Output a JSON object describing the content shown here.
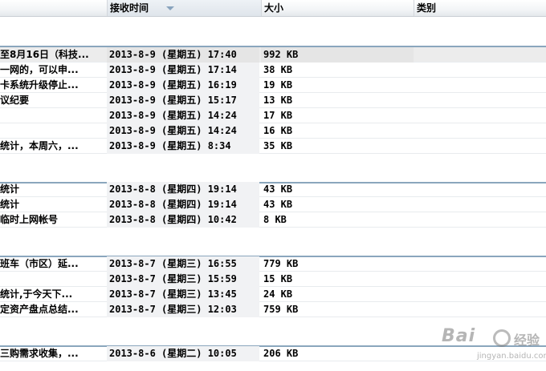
{
  "columns": {
    "time": "接收时间",
    "size": "大小",
    "category": "类别"
  },
  "rows": [
    {
      "subject": "至8月16日（科技...",
      "time": "2013-8-9 (星期五) 17:40",
      "size": "992 KB"
    },
    {
      "subject": "一网的，可以申...",
      "time": "2013-8-9 (星期五) 17:14",
      "size": "38 KB"
    },
    {
      "subject": "卡系统升级停止...",
      "time": "2013-8-9 (星期五) 16:19",
      "size": "19 KB"
    },
    {
      "subject": "议纪要",
      "time": "2013-8-9 (星期五) 15:17",
      "size": "13 KB"
    },
    {
      "subject": "",
      "time": "2013-8-9 (星期五) 14:24",
      "size": "17 KB"
    },
    {
      "subject": "",
      "time": "2013-8-9 (星期五) 14:24",
      "size": "16 KB"
    },
    {
      "subject": "统计，本周六，...",
      "time": "2013-8-9 (星期五) 8:34",
      "size": "35 KB"
    },
    {
      "subject": "统计",
      "time": "2013-8-8 (星期四) 19:14",
      "size": "43 KB"
    },
    {
      "subject": "统计",
      "time": "2013-8-8 (星期四) 19:14",
      "size": "43 KB"
    },
    {
      "subject": "临时上网帐号",
      "time": "2013-8-8 (星期四) 10:42",
      "size": "8 KB"
    },
    {
      "subject": "班车（市区）延...",
      "time": "2013-8-7 (星期三) 16:55",
      "size": "779 KB"
    },
    {
      "subject": "",
      "time": "2013-8-7 (星期三) 15:59",
      "size": "15 KB"
    },
    {
      "subject": "统计,于今天下...",
      "time": "2013-8-7 (星期三) 13:45",
      "size": "24 KB"
    },
    {
      "subject": "定资产盘点总结...",
      "time": "2013-8-7 (星期三) 12:03",
      "size": "759 KB"
    },
    {
      "subject": "三购需求收集，...",
      "time": "2013-8-6 (星期二) 10:05",
      "size": "206 KB"
    }
  ],
  "watermark": {
    "brand": "Bai",
    "brand_cn": "经验",
    "url": "jingyan.baidu.com"
  }
}
